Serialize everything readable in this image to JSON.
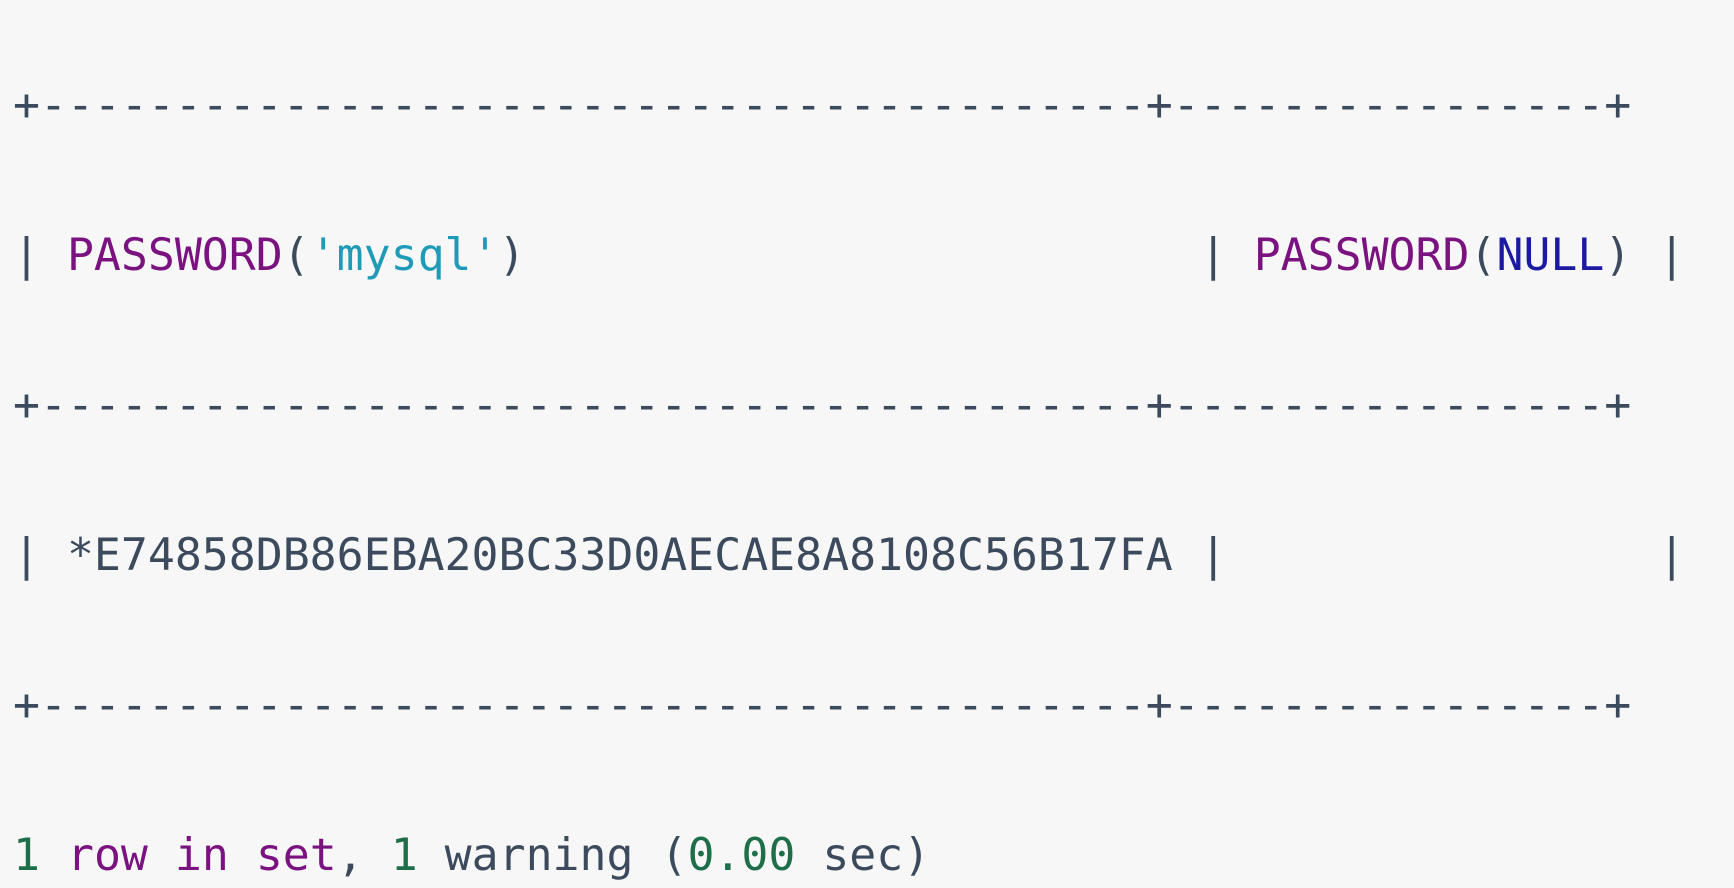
{
  "output": {
    "border_line": "+-----------------------------------------+----------------+",
    "header": {
      "col1_func": "PASSWORD",
      "col1_open": "(",
      "col1_arg": "'mysql'",
      "col1_close": ")",
      "col1_pad": "                        ",
      "col2_func": "PASSWORD",
      "col2_open": "(",
      "col2_arg": "NULL",
      "col2_close": ")"
    },
    "row": {
      "col1_value": "*E74858DB86EBA20BC33D0AECAE8A8108C56B17FA",
      "col2_value": "               "
    },
    "summary": {
      "count": "1",
      "row_word": "row",
      "in_word": "in",
      "set_word": "set",
      "comma": ",",
      "warning_count": "1",
      "warning_word": "warning",
      "open_paren": "(",
      "seconds": "0.00",
      "sec_word": "sec",
      "close_paren": ")"
    }
  },
  "colors": {
    "background": "#f7f7f7",
    "text": "#3b4a5c",
    "keyword": "#7a1280",
    "string": "#1f9bb8",
    "null_literal": "#1b1aa0",
    "number": "#1f6e4a"
  }
}
